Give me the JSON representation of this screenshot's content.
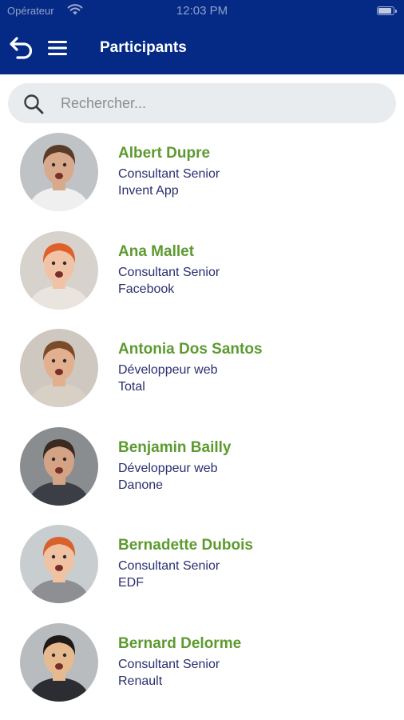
{
  "status_bar": {
    "carrier": "Opérateur",
    "time": "12:03 PM",
    "battery_level": 0.9
  },
  "nav": {
    "title": "Participants",
    "back_icon": "undo-arrow-icon",
    "menu_icon": "hamburger-menu-icon"
  },
  "search": {
    "placeholder": "Rechercher...",
    "value": ""
  },
  "colors": {
    "header": "#052a86",
    "name": "#5c9a2f",
    "subtitle": "#2a2f6e",
    "search_bg": "#e9ecef"
  },
  "participants": [
    {
      "name": "Albert Dupre",
      "role": "Consultant Senior",
      "company": "Invent App"
    },
    {
      "name": "Ana Mallet",
      "role": "Consultant Senior",
      "company": "Facebook"
    },
    {
      "name": "Antonia Dos Santos",
      "role": "Développeur web",
      "company": "Total"
    },
    {
      "name": "Benjamin Bailly",
      "role": "Développeur web",
      "company": "Danone"
    },
    {
      "name": "Bernadette Dubois",
      "role": "Consultant Senior",
      "company": "EDF"
    },
    {
      "name": "Bernard Delorme",
      "role": "Consultant Senior",
      "company": "Renault"
    }
  ]
}
